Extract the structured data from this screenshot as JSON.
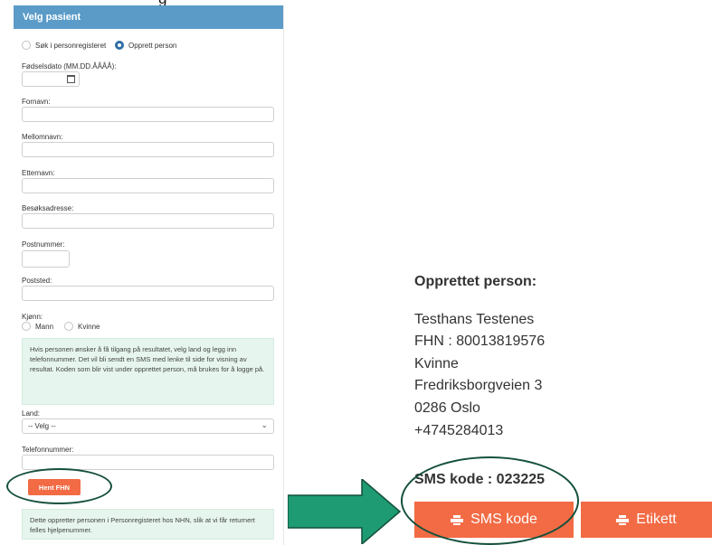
{
  "panel": {
    "header": "Velg pasient",
    "radio_search": "Søk i personregisteret",
    "radio_create": "Opprett person",
    "labels": {
      "dob": "Fødselsdato (MM.DD.ÅÅÅÅ):",
      "first_name": "Fornavn:",
      "middle_name": "Mellomnavn:",
      "last_name": "Etternavn:",
      "address": "Besøksadresse:",
      "postnr": "Postnummer:",
      "poststed": "Poststed:",
      "gender": "Kjønn:",
      "male": "Mann",
      "female": "Kvinne",
      "country": "Land:",
      "phone": "Telefonnummer:"
    },
    "info_text": "Hvis personen ønsker å få tilgang på resultatet, velg land og legg inn telefonnummer. Det vil bli sendt en SMS med lenke til side for visning av resultat. Koden som blir vist under opprettet person, må brukes for å logge på.",
    "country_select": "-- Velg --",
    "fhn_button": "Hent FHN",
    "bottom_info": "Dette oppretter personen i Personregisteret hos NHN, slik at vi får returnert felles hjelpenummer."
  },
  "result": {
    "title": "Opprettet person:",
    "name": "Testhans Testenes",
    "fhn": "FHN : 80013819576",
    "gender": "Kvinne",
    "street": "Fredriksborgveien 3",
    "city": "0286 Oslo",
    "phone": "+4745284013",
    "sms_code": "SMS kode : 023225",
    "sms_button": "SMS kode",
    "label_button": "Etikett"
  },
  "colors": {
    "header": "#5b9bc8",
    "accent": "#f26b45",
    "arrow": "#1e9b72",
    "outline": "#14503c",
    "info_bg": "#e6f5ee"
  }
}
